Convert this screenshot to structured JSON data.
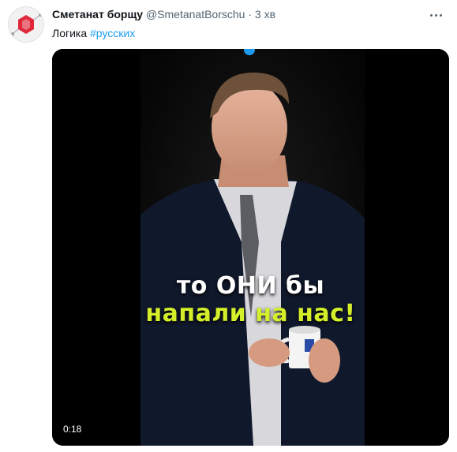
{
  "tweet": {
    "author_name": "Сметанат борщу",
    "handle": "@SmetanatBorschu",
    "separator": "·",
    "time": "3 хв",
    "text": "Логика ",
    "hashtag": "#русских"
  },
  "video": {
    "caption_line1": "то ОНИ бы",
    "caption_line2": "напали на нас!",
    "duration": "0:18"
  },
  "icons": {
    "more": "more-horizontal-icon",
    "avatar": "hexagon-logo"
  },
  "colors": {
    "link": "#1d9bf0",
    "caption_accent": "#d4ef2a",
    "secondary_text": "#536471"
  }
}
